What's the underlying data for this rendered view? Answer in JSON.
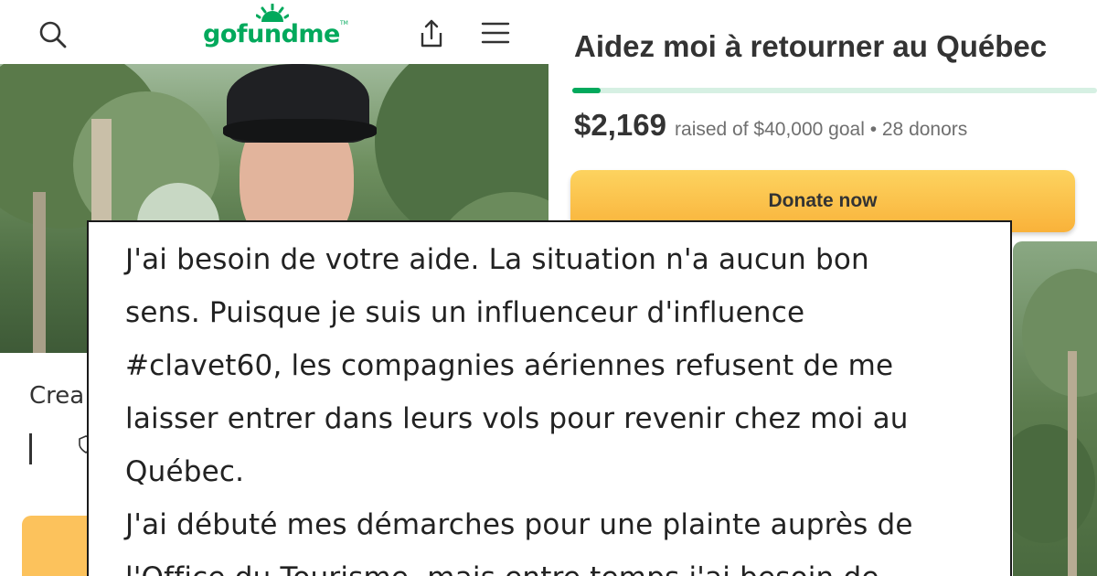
{
  "brand": {
    "logo_text": "gofundme",
    "logo_tm": "TM",
    "color": "#02a95c"
  },
  "header": {
    "icons": [
      "search-icon",
      "share-icon",
      "menu-icon"
    ]
  },
  "campaign": {
    "title": "Aidez moi à retourner au Québec",
    "raised": "$2,169",
    "raised_text": "raised of $40,000 goal • 28 donors",
    "progress_fraction": 0.054,
    "donate_label": "Donate now",
    "donate_color": "#f9b23a"
  },
  "left_page": {
    "creator_partial": "Crea"
  },
  "story": {
    "lines": [
      "J'ai besoin de votre aide. La situation n'a aucun bon",
      "sens. Puisque je suis un influenceur d'influence",
      "#clavet60, les compagnies aériennes refusent de me",
      "laisser entrer dans leurs vols pour revenir chez moi au",
      "Québec.",
      "J'ai débuté mes démarches pour une plainte auprès de",
      "l'Office du Tourisme, mais entre temps j'ai besoin de"
    ]
  }
}
